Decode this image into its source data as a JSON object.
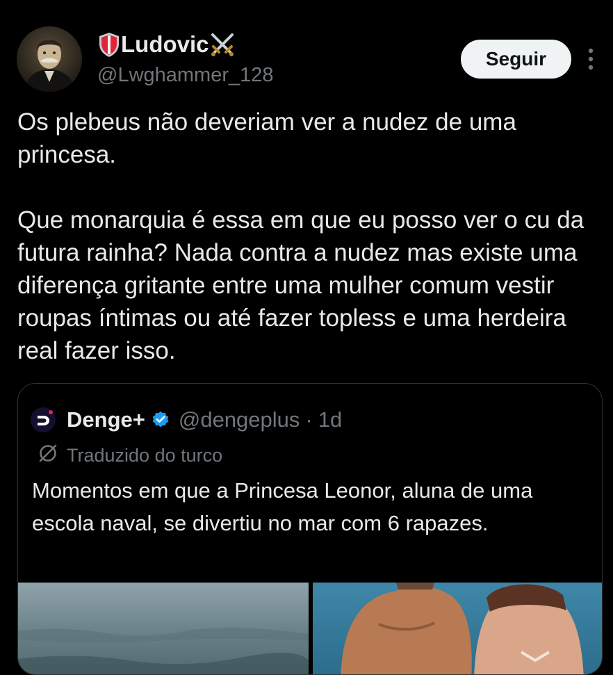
{
  "author": {
    "display_name": "Ludovic",
    "handle": "@Lwghammer_128",
    "name_prefix_icon": "shield-icon",
    "name_suffix_icon": "crossed-swords-icon"
  },
  "actions": {
    "follow_label": "Seguir",
    "more_icon": "more-vertical-icon"
  },
  "tweet": {
    "paragraphs": [
      "Os plebeus não deveriam ver a nudez de uma princesa.",
      "Que monarquia é essa em que eu posso ver o cu da futura rainha? Nada contra a nudez mas existe uma diferença gritante entre uma mulher comum vestir roupas íntimas ou até fazer topless e uma herdeira real fazer isso."
    ]
  },
  "quote": {
    "name": "Denge+",
    "handle": "@dengeplus",
    "separator": "·",
    "time": "1d",
    "verified_icon": "verified-badge-icon",
    "translated_label": "Traduzido do turco",
    "text": "Momentos em que a Princesa Leonor, aluna de uma escola naval, se divertiu no mar com 6 rapazes."
  },
  "colors": {
    "background": "#000000",
    "text_primary": "#e7e9ea",
    "text_secondary": "#71767b",
    "follow_button_bg": "#eff3f4",
    "verified_blue": "#1d9bf0",
    "border": "#2f3336"
  }
}
